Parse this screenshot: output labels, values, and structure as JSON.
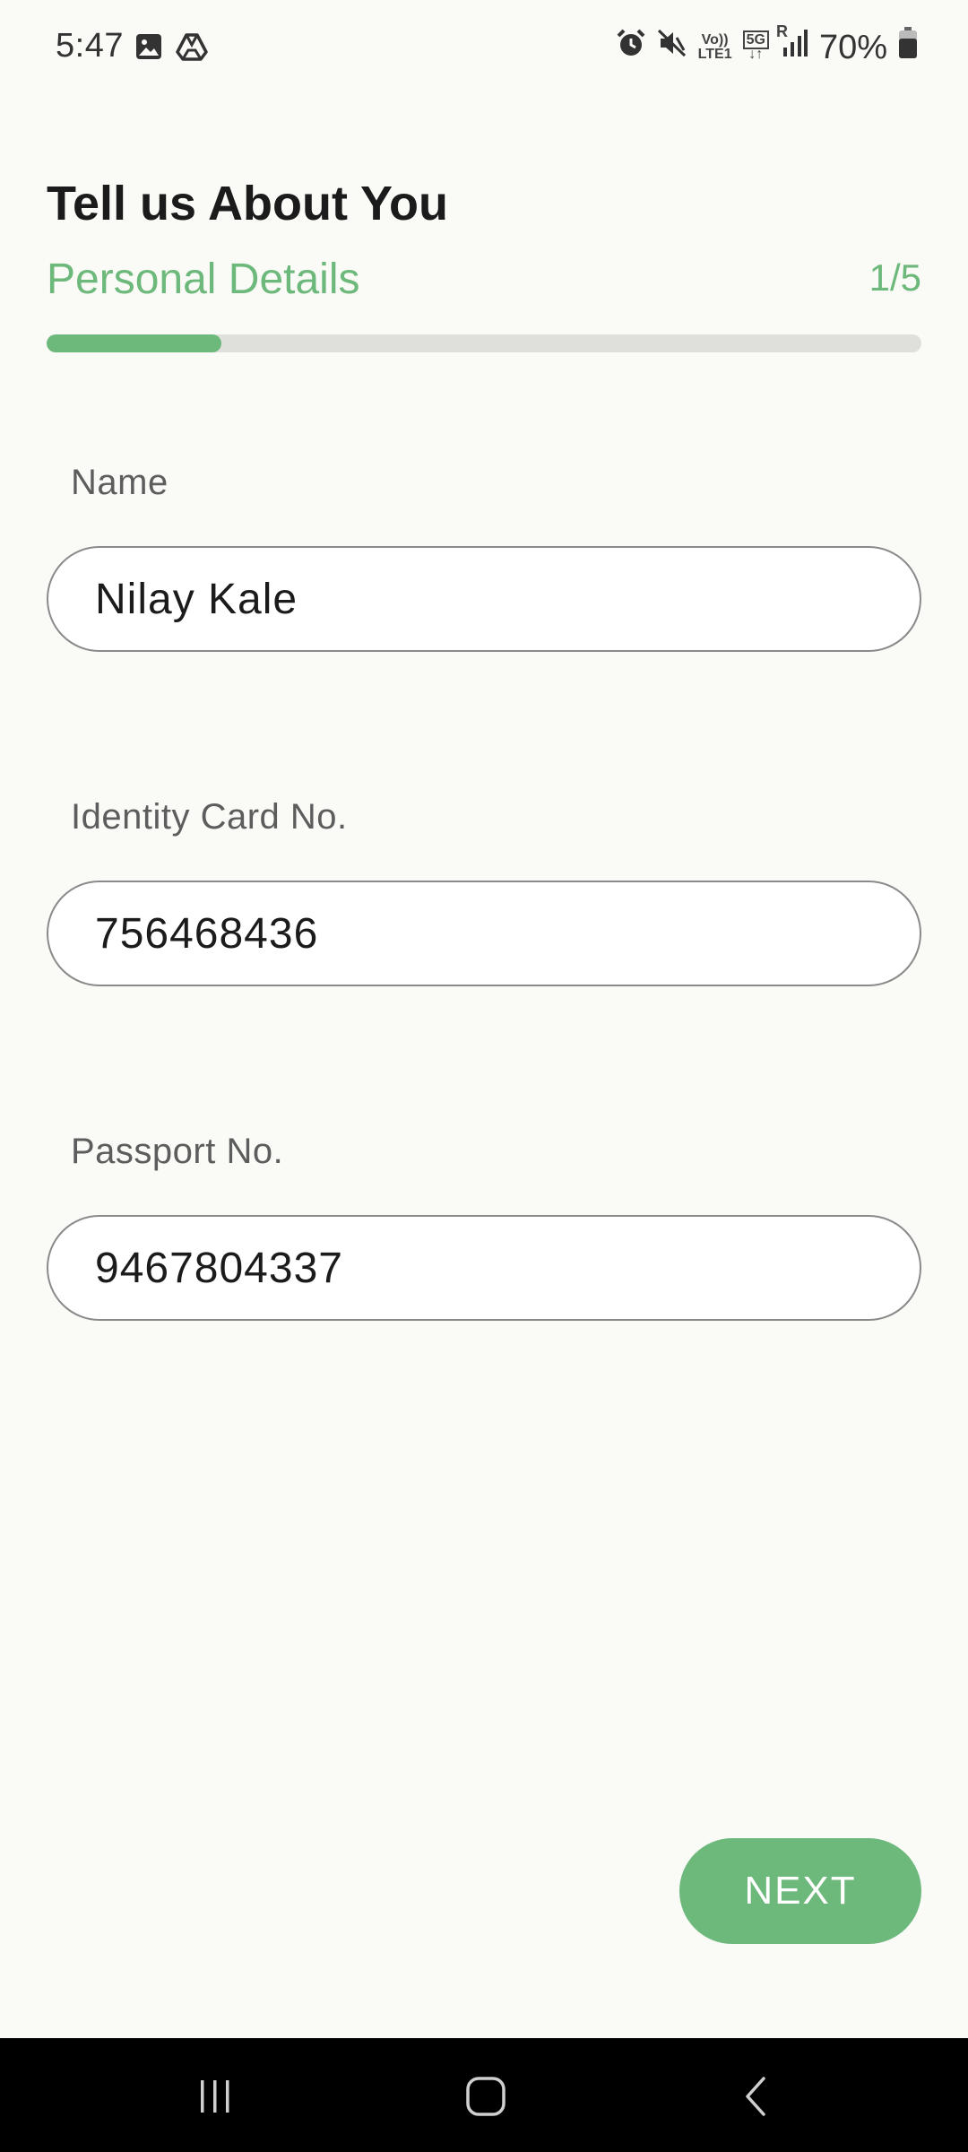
{
  "status_bar": {
    "time": "5:47",
    "battery": "70%",
    "network_top": "Vo))",
    "network_bottom": "LTE1",
    "network_5g": "5G",
    "roaming": "R",
    "icons": [
      "gallery-icon",
      "drive-icon",
      "alarm-icon",
      "mute-icon",
      "volte-icon",
      "5g-icon",
      "signal-icon",
      "battery-icon"
    ]
  },
  "header": {
    "title": "Tell us About You",
    "step_label": "Personal Details",
    "step_counter": "1/5",
    "progress_fraction": 0.2
  },
  "form": {
    "name_label": "Name",
    "name_value": "Nilay Kale",
    "id_label": "Identity Card No.",
    "id_value": "756468436",
    "passport_label": "Passport No.",
    "passport_value": "9467804337"
  },
  "actions": {
    "next_label": "NEXT"
  },
  "nav_bar": {
    "icons": [
      "recent-apps-icon",
      "home-icon",
      "back-icon"
    ]
  },
  "colors": {
    "accent": "#6db87b",
    "background": "#fafbf7",
    "nav_background": "#000000"
  }
}
